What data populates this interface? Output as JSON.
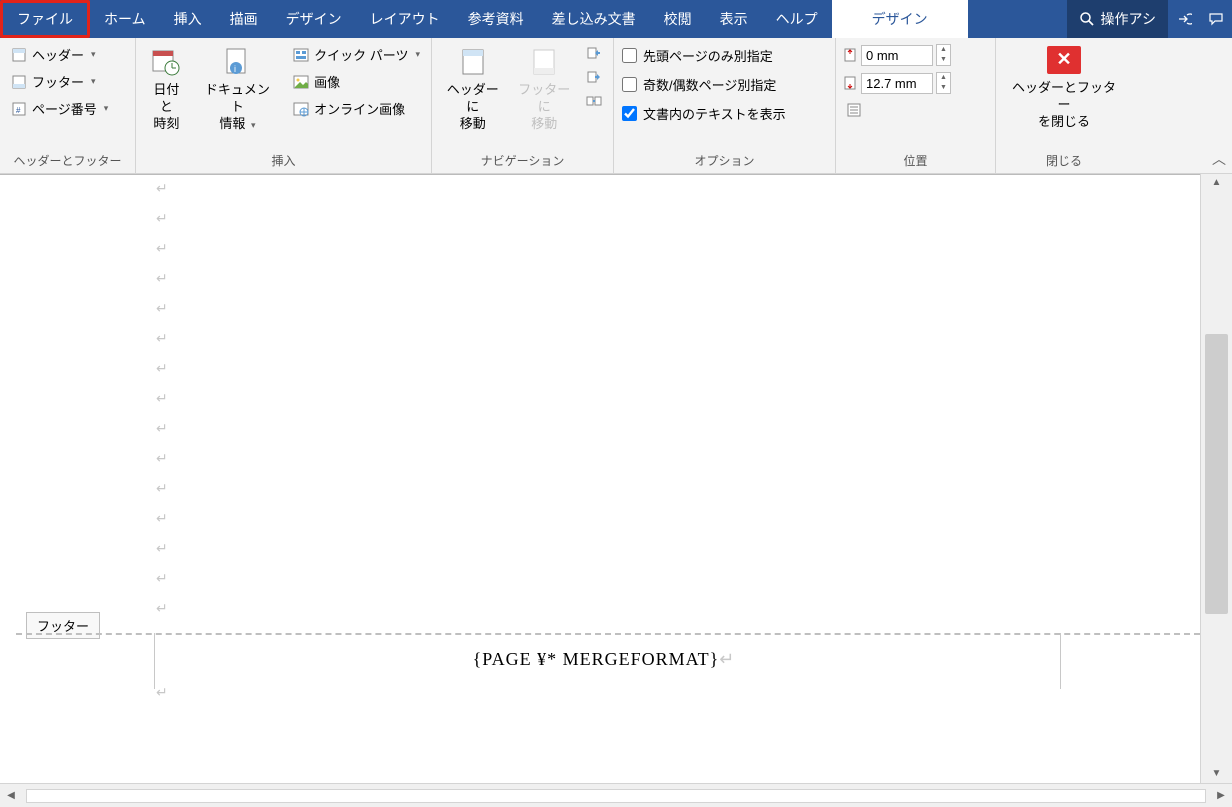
{
  "tabs": {
    "file": "ファイル",
    "home": "ホーム",
    "insert": "挿入",
    "draw": "描画",
    "design": "デザイン",
    "layout": "レイアウト",
    "references": "参考資料",
    "mailings": "差し込み文書",
    "review": "校閲",
    "view": "表示",
    "help": "ヘルプ",
    "context": "デザイン",
    "search": "操作アシ"
  },
  "hf_group": {
    "header": "ヘッダー",
    "footer": "フッター",
    "page_number": "ページ番号",
    "label": "ヘッダーとフッター"
  },
  "insert_group": {
    "datetime1": "日付と",
    "datetime2": "時刻",
    "docinfo1": "ドキュメント",
    "docinfo2": "情報",
    "quickparts": "クイック パーツ",
    "picture": "画像",
    "online_picture": "オンライン画像",
    "label": "挿入"
  },
  "nav_group": {
    "goto_header1": "ヘッダーに",
    "goto_header2": "移動",
    "goto_footer1": "フッターに",
    "goto_footer2": "移動",
    "label": "ナビゲーション"
  },
  "options_group": {
    "first_page": "先頭ページのみ別指定",
    "odd_even": "奇数/偶数ページ別指定",
    "show_text": "文書内のテキストを表示",
    "label": "オプション"
  },
  "position_group": {
    "top": "0 mm",
    "bottom": "12.7 mm",
    "label": "位置"
  },
  "close_group": {
    "line1": "ヘッダーとフッター",
    "line2": "を閉じる",
    "label": "閉じる"
  },
  "document": {
    "footer_tag": "フッター",
    "footer_field": "{PAGE   ¥* MERGEFORMAT}",
    "pilcrow": "↵"
  }
}
